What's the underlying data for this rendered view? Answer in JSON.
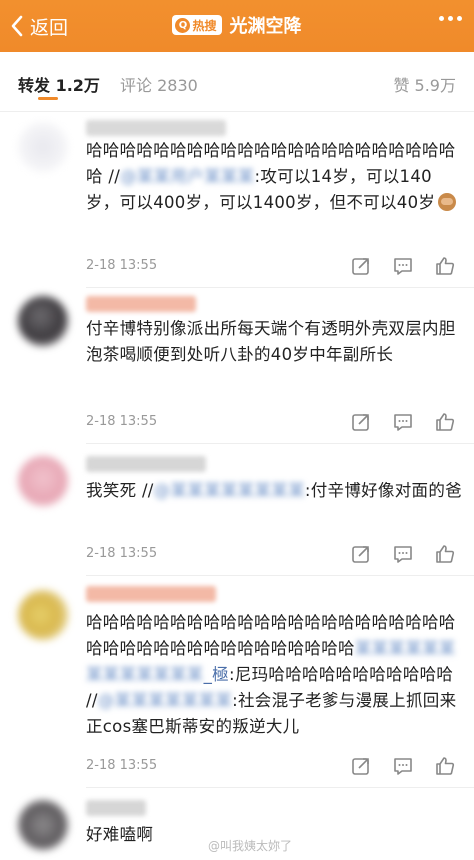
{
  "header": {
    "back_label": "返回",
    "hot_badge_icon": "Q",
    "hot_badge_text": "热搜",
    "title": "光渊空降",
    "bg_color": "#f08a2a"
  },
  "tabs": {
    "repost_label": "转发 1.2万",
    "comment_label": "评论 2830",
    "like_label": "赞 5.9万",
    "accent_color": "#f08a2a"
  },
  "comments": [
    {
      "text_pre": "哈哈哈哈哈哈哈哈哈哈哈哈哈哈哈哈哈哈哈哈哈哈哈 //",
      "hidden_user": "@某某用户某某某",
      "text_post": ":攻可以14岁，可以140岁，可以400岁，可以1400岁，但不可以40岁",
      "emoji": "see-no-evil-monkey",
      "time": "2-18 13:55"
    },
    {
      "text": "付辛博特别像派出所每天端个有透明外壳双层内胆泡茶喝顺便到处听八卦的40岁中年副所长",
      "time": "2-18 13:55"
    },
    {
      "text_pre": "我笑死 //",
      "hidden_user": "@某某某某某某某某",
      "text_post": ":付辛博好像对面的爸",
      "time": "2-18 13:55"
    },
    {
      "text_pre": "哈哈哈哈哈哈哈哈哈哈哈哈哈哈哈哈哈哈哈哈哈哈哈哈哈哈哈哈哈哈哈哈哈哈哈哈哈哈",
      "hidden_user_a": "某某某某某某某某某某某某某",
      "visible_user_a": "_極",
      "text_mid": ":尼玛哈哈哈哈哈哈哈哈哈哈哈 //",
      "hidden_user_b": "@某某某某某某某",
      "text_post": ":社会混子老爹与漫展上抓回来正cos塞巴斯蒂安的叛逆大儿",
      "time": "2-18 13:55"
    },
    {
      "text": "好难嗑啊"
    }
  ],
  "watermark": "@叫我姨太妳了"
}
